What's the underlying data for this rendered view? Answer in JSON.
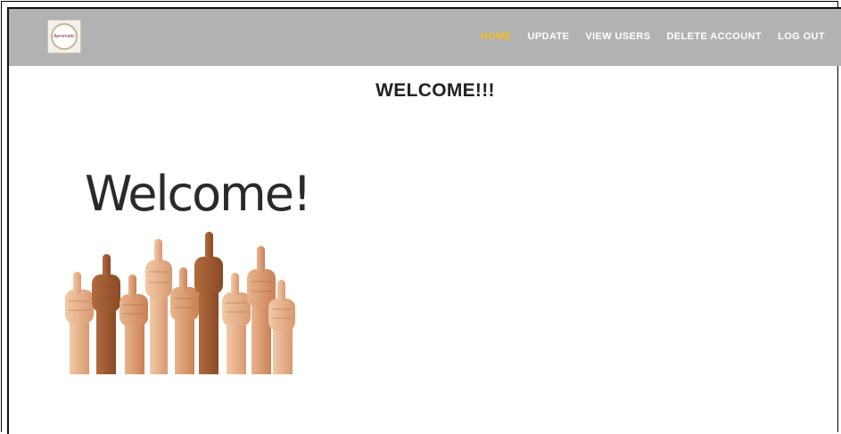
{
  "navbar": {
    "logo_icon": "aeromatic-logo",
    "logo_text": "Aeromatic",
    "items": [
      {
        "label": "HOME",
        "active": true
      },
      {
        "label": "UPDATE",
        "active": false
      },
      {
        "label": "VIEW USERS",
        "active": false
      },
      {
        "label": "DELETE ACCOUNT",
        "active": false
      },
      {
        "label": "LOG OUT",
        "active": false
      }
    ],
    "background_color": "#b2b2b2",
    "active_color": "#f5c21b"
  },
  "main": {
    "title": "WELCOME!!!",
    "image": {
      "caption_text": "Welcome!",
      "icon": "thumbs-up-hands-image"
    }
  }
}
